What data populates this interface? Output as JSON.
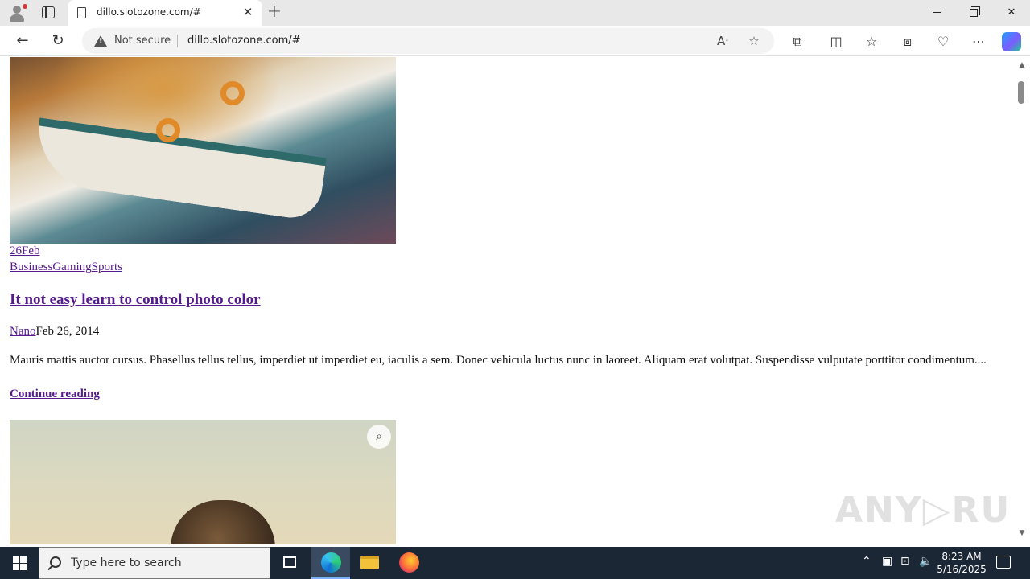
{
  "browser": {
    "tab_title": "dillo.slotozone.com/#",
    "tab_close": "✕",
    "new_tab": "+",
    "security_label": "Not secure",
    "url": "dillo.slotozone.com/#"
  },
  "window_controls": {
    "close": "✕"
  },
  "post": {
    "date": "26Feb",
    "categories": [
      "Business",
      "Gaming",
      "Sports"
    ],
    "title": "It not easy learn to control photo color",
    "author": "Nano",
    "published": "Feb 26, 2014",
    "excerpt": "Mauris mattis auctor cursus. Phasellus tellus tellus, imperdiet ut imperdiet eu, iaculis a sem. Donec vehicula luctus nunc in laoreet. Aliquam erat volutpat. Suspendisse vulputate porttitor condimentum....",
    "read_more": "Continue reading"
  },
  "watermark": "ANY RUN",
  "taskbar": {
    "search_placeholder": "Type here to search",
    "time": "8:23 AM",
    "date": "5/16/2025"
  },
  "icons": {
    "back": "back-arrow-icon",
    "refresh": "refresh-icon",
    "warning": "warning-icon",
    "read_aloud": "read-aloud-icon",
    "favorite": "star-icon",
    "extensions": "puzzle-icon",
    "split": "split-screen-icon",
    "favorites": "favorites-icon",
    "collections": "collections-icon",
    "performance": "heart-pulse-icon",
    "more": "more-icon",
    "copilot": "copilot-icon",
    "visual_search": "visual-search-icon"
  }
}
